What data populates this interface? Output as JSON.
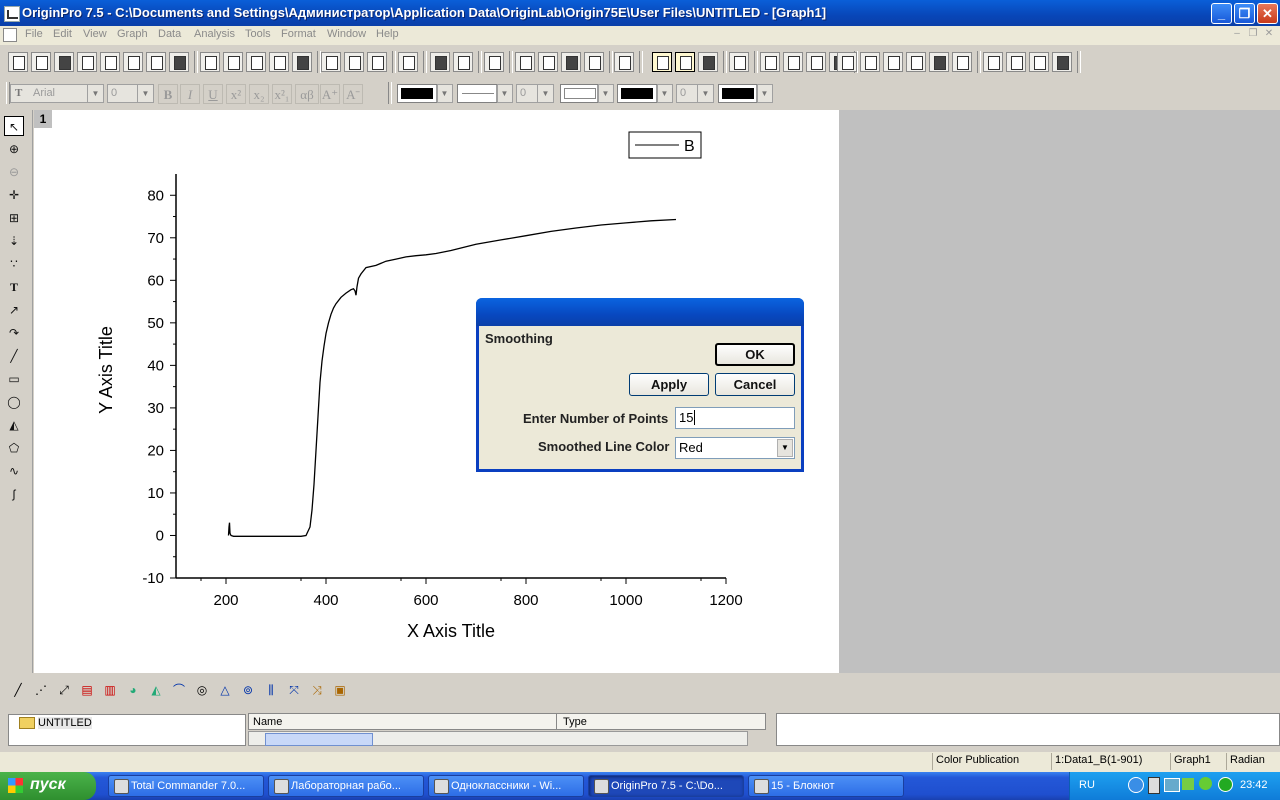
{
  "window": {
    "title": "OriginPro 7.5 - C:\\Documents and Settings\\Администратор\\Application Data\\OriginLab\\Origin75E\\User Files\\UNTITLED - [Graph1]"
  },
  "menu": [
    "File",
    "Edit",
    "View",
    "Graph",
    "Data",
    "Analysis",
    "Tools",
    "Format",
    "Window",
    "Help"
  ],
  "format_toolbar": {
    "font": "Arial",
    "font_size": "0",
    "line_width": "0",
    "pattern_size": "0"
  },
  "graph": {
    "layer_label": "1",
    "legend": "B",
    "xlabel": "X Axis Title",
    "ylabel": "Y Axis Title"
  },
  "chart_data": {
    "type": "line",
    "xlim": [
      100,
      1200
    ],
    "ylim": [
      -10,
      85
    ],
    "x_ticks": [
      200,
      400,
      600,
      800,
      1000,
      1200
    ],
    "y_ticks": [
      -10,
      0,
      10,
      20,
      30,
      40,
      50,
      60,
      70,
      80
    ],
    "series": [
      {
        "name": "B",
        "x": [
          205,
          206,
          207,
          208,
          210,
          215,
          250,
          300,
          350,
          360,
          368,
          372,
          376,
          380,
          384,
          388,
          392,
          396,
          400,
          405,
          410,
          415,
          420,
          430,
          440,
          450,
          455,
          458,
          460,
          462,
          465,
          470,
          480,
          500,
          520,
          540,
          560,
          580,
          600,
          620,
          650,
          700,
          750,
          800,
          850,
          900,
          950,
          1000,
          1050,
          1100
        ],
        "y": [
          0,
          2,
          3,
          0.5,
          0,
          -0.2,
          -0.2,
          -0.2,
          -0.2,
          0,
          2,
          6,
          12,
          20,
          28,
          36,
          41,
          44.5,
          47.5,
          50,
          52,
          53.5,
          54.5,
          56,
          57,
          57.8,
          58,
          57.5,
          56.5,
          58.5,
          60.5,
          61.5,
          63,
          63.5,
          64.5,
          65,
          65.5,
          65.8,
          66,
          66.3,
          67,
          68.5,
          69.5,
          70.5,
          71.5,
          72.3,
          73,
          73.5,
          74,
          74.3
        ]
      }
    ]
  },
  "dialog": {
    "heading": "Smoothing",
    "ok": "OK",
    "apply": "Apply",
    "cancel": "Cancel",
    "points_label": "Enter Number of Points",
    "points_value": "15",
    "color_label": "Smoothed Line Color",
    "color_value": "Red"
  },
  "explorer": {
    "folder": "UNTITLED",
    "col_name": "Name",
    "col_type": "Type"
  },
  "status": {
    "mode": "Color Publication",
    "data": "1:Data1_B(1-901)",
    "window": "Graph1",
    "angle": "Radian"
  },
  "taskbar": {
    "start": "пуск",
    "tasks": [
      "Total Commander 7.0...",
      "Лабораторная рабо...",
      "Одноклассники - Wi...",
      "OriginPro 7.5 - C:\\Do...",
      "15 - Блокнот"
    ],
    "lang": "RU",
    "clock": "23:42"
  }
}
